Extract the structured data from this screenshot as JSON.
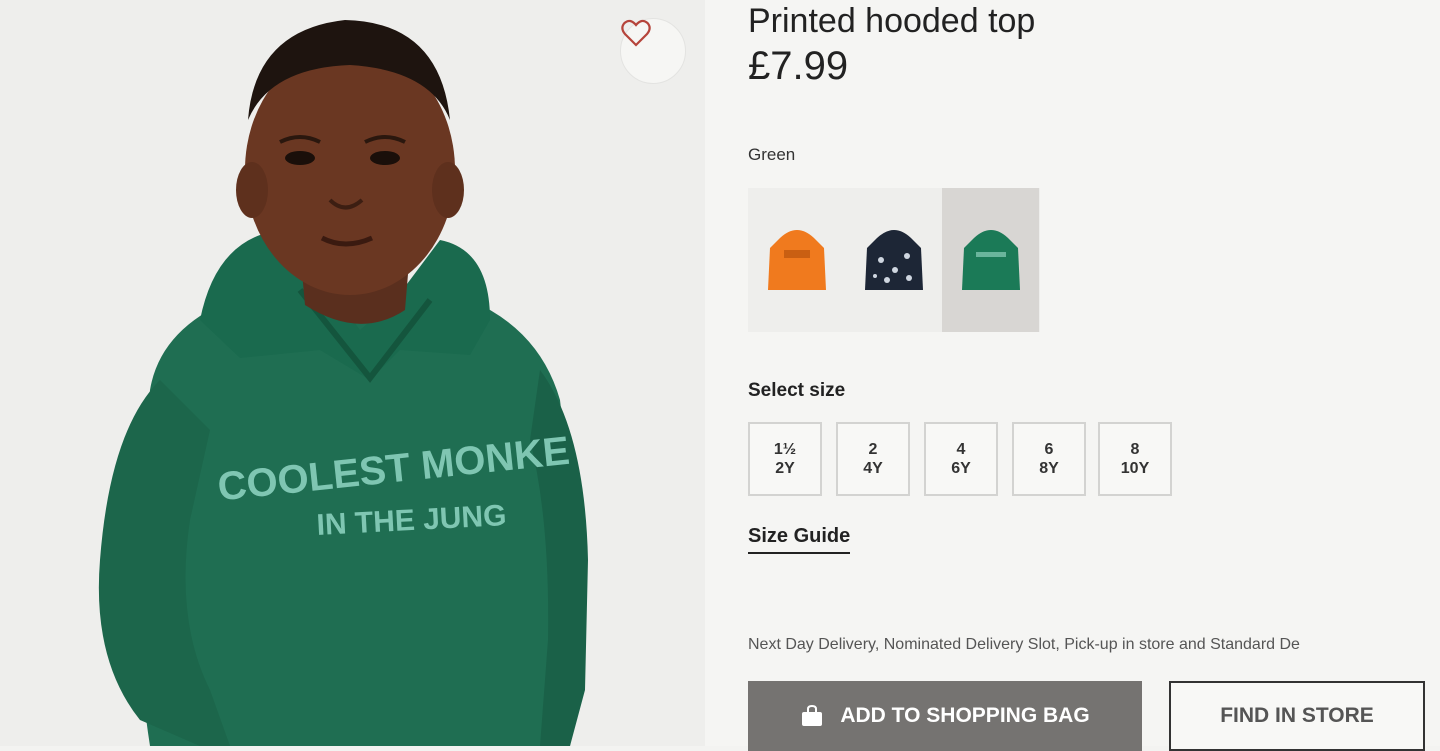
{
  "product": {
    "title": "Printed hooded top",
    "price": "£7.99",
    "selected_color": "Green",
    "hoodie_print_line1": "COOLEST MONKE",
    "hoodie_print_line2": "IN THE JUNG"
  },
  "swatches": [
    {
      "name": "orange",
      "color": "#f07a1e",
      "selected": false
    },
    {
      "name": "navy-print",
      "color": "#1d2636",
      "selected": false
    },
    {
      "name": "green",
      "color": "#1b7a57",
      "selected": true
    }
  ],
  "size_section": {
    "label": "Select size",
    "options": [
      {
        "line1": "1½",
        "line2": "2Y"
      },
      {
        "line1": "2",
        "line2": "4Y"
      },
      {
        "line1": "4",
        "line2": "6Y"
      },
      {
        "line1": "6",
        "line2": "8Y"
      },
      {
        "line1": "8",
        "line2": "10Y"
      }
    ],
    "guide_label": "Size Guide"
  },
  "delivery_text": "Next Day Delivery, Nominated Delivery Slot, Pick-up in store and Standard De",
  "actions": {
    "add_to_bag": "ADD TO SHOPPING BAG",
    "find_in_store": "FIND IN STORE"
  },
  "icons": {
    "favorite": "heart-icon",
    "bag": "shopping-bag-icon"
  }
}
